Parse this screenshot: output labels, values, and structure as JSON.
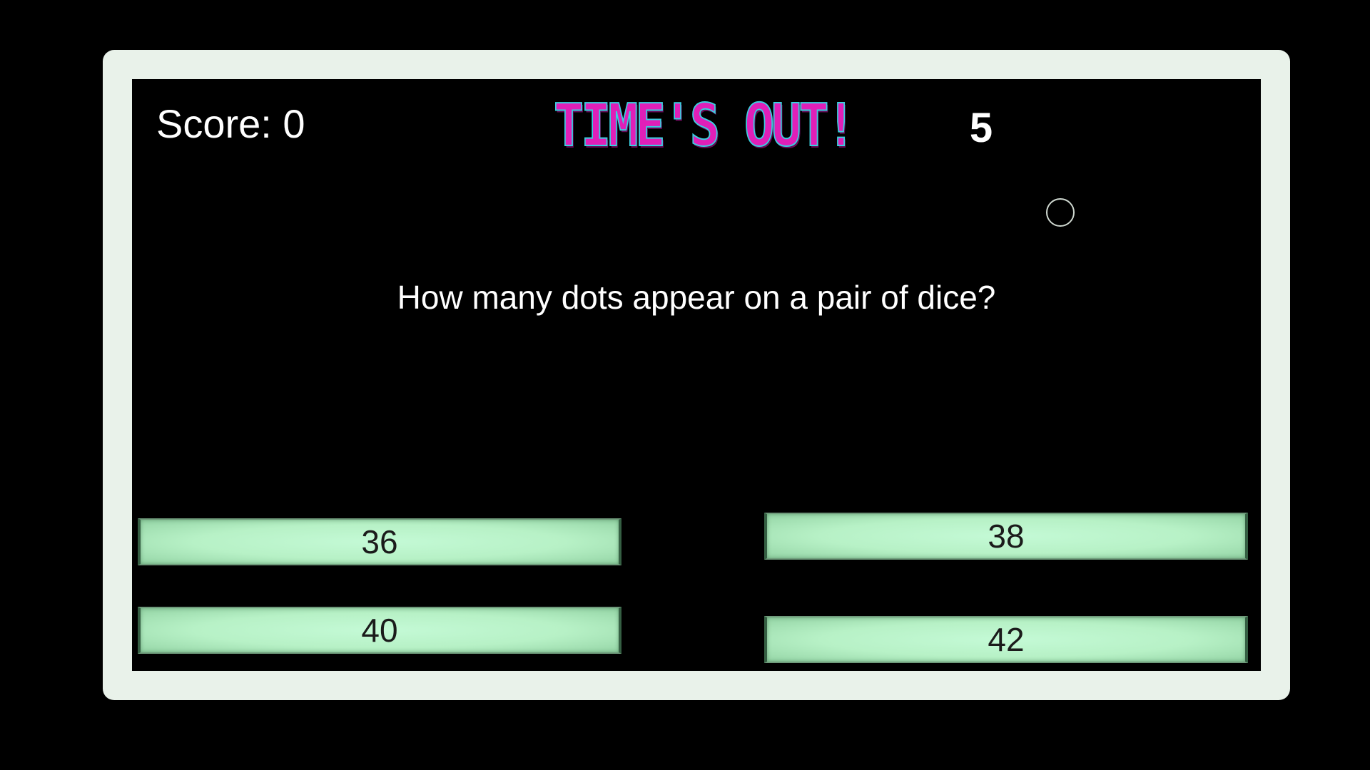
{
  "hud": {
    "score_text": "Score: 0",
    "title": "TIME'S OUT!",
    "timer": "5"
  },
  "question": {
    "text": "How many dots appear on a pair of dice?"
  },
  "answers": [
    {
      "label": "36"
    },
    {
      "label": "38"
    },
    {
      "label": "40"
    },
    {
      "label": "42"
    }
  ],
  "colors": {
    "frame": "#e9f2ea",
    "screen_background": "#000000",
    "answer_button": "#b7f1c6",
    "title_text": "#e01fb8",
    "title_outline": "#3ad0e0"
  }
}
